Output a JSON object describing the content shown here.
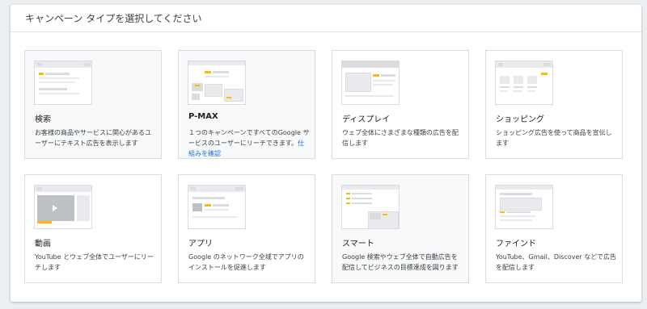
{
  "header": {
    "title": "キャンペーン タイプを選択してください"
  },
  "cards": [
    {
      "title": "検索",
      "desc": "お客様の商品やサービスに関心があるユーザーにテキスト広告を表示します"
    },
    {
      "title": "P-MAX",
      "desc": "１つのキャンペーンですべてのGoogle サービスのユーザーにリーチできます。",
      "link": "仕組みを確認"
    },
    {
      "title": "ディスプレイ",
      "desc": "ウェブ全体にさまざまな種類の広告を配信します"
    },
    {
      "title": "ショッピング",
      "desc": "ショッピング広告を使って商品を宣伝します"
    },
    {
      "title": "動画",
      "desc": "YouTube とウェブ全体でユーザーにリーチします"
    },
    {
      "title": "アプリ",
      "desc": "Google のネットワーク全域でアプリのインストールを促進します"
    },
    {
      "title": "スマート",
      "desc": "Google 検索やウェブ全体で自動広告を配信してビジネスの目標達成を図ります"
    },
    {
      "title": "ファインド",
      "desc": "YouTube、Gmail、Discover などで広告を配信します"
    }
  ],
  "colors": {
    "accent": "#fbbc04",
    "link": "#1a73e8",
    "border": "#dadce0"
  }
}
